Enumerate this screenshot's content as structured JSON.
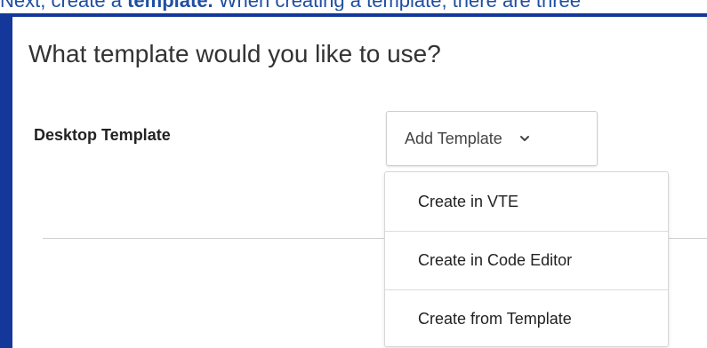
{
  "caption": {
    "prefix": "Next, create a ",
    "strong": "template.",
    "suffix": " When creating a template, there are three"
  },
  "dialog": {
    "title": "What template would you like to use?",
    "field_label": "Desktop Template",
    "add_template_label": "Add Template"
  },
  "dropdown": {
    "items": [
      {
        "label": "Create in VTE"
      },
      {
        "label": "Create in Code Editor"
      },
      {
        "label": "Create from Template"
      }
    ]
  },
  "icons": {
    "dropdown_chevron": "chevron-down-icon"
  },
  "colors": {
    "frame_blue": "#13389a",
    "caption_blue": "#1f4fa3",
    "text_dark": "#333333",
    "border_gray": "#cfcfcf"
  }
}
